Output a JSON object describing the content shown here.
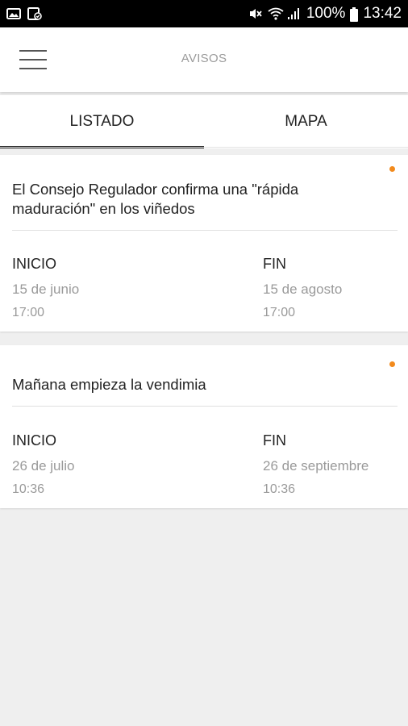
{
  "status_bar": {
    "battery": "100%",
    "time": "13:42",
    "icons": [
      "image-icon",
      "gallery-check-icon",
      "mute-icon",
      "wifi-icon",
      "signal-icon",
      "battery-icon"
    ]
  },
  "app_bar": {
    "title": "AVISOS",
    "menu_icon": "hamburger-menu-icon"
  },
  "tabs": [
    {
      "label": "LISTADO",
      "active": true
    },
    {
      "label": "MAPA",
      "active": false
    }
  ],
  "colors": {
    "accent_dot": "#f28a1c",
    "tab_indicator": "#222222",
    "background": "#efefef"
  },
  "notices": [
    {
      "title": "El Consejo Regulador confirma una \"rápida maduración\" en los viñedos",
      "start_label": "INICIO",
      "start_date": "15 de junio",
      "start_time": "17:00",
      "end_label": "FIN",
      "end_date": "15 de agosto",
      "end_time": "17:00",
      "unread": true
    },
    {
      "title": "Mañana empieza la vendimia",
      "start_label": "INICIO",
      "start_date": "26 de julio",
      "start_time": "10:36",
      "end_label": "FIN",
      "end_date": "26 de septiembre",
      "end_time": "10:36",
      "unread": true
    }
  ]
}
